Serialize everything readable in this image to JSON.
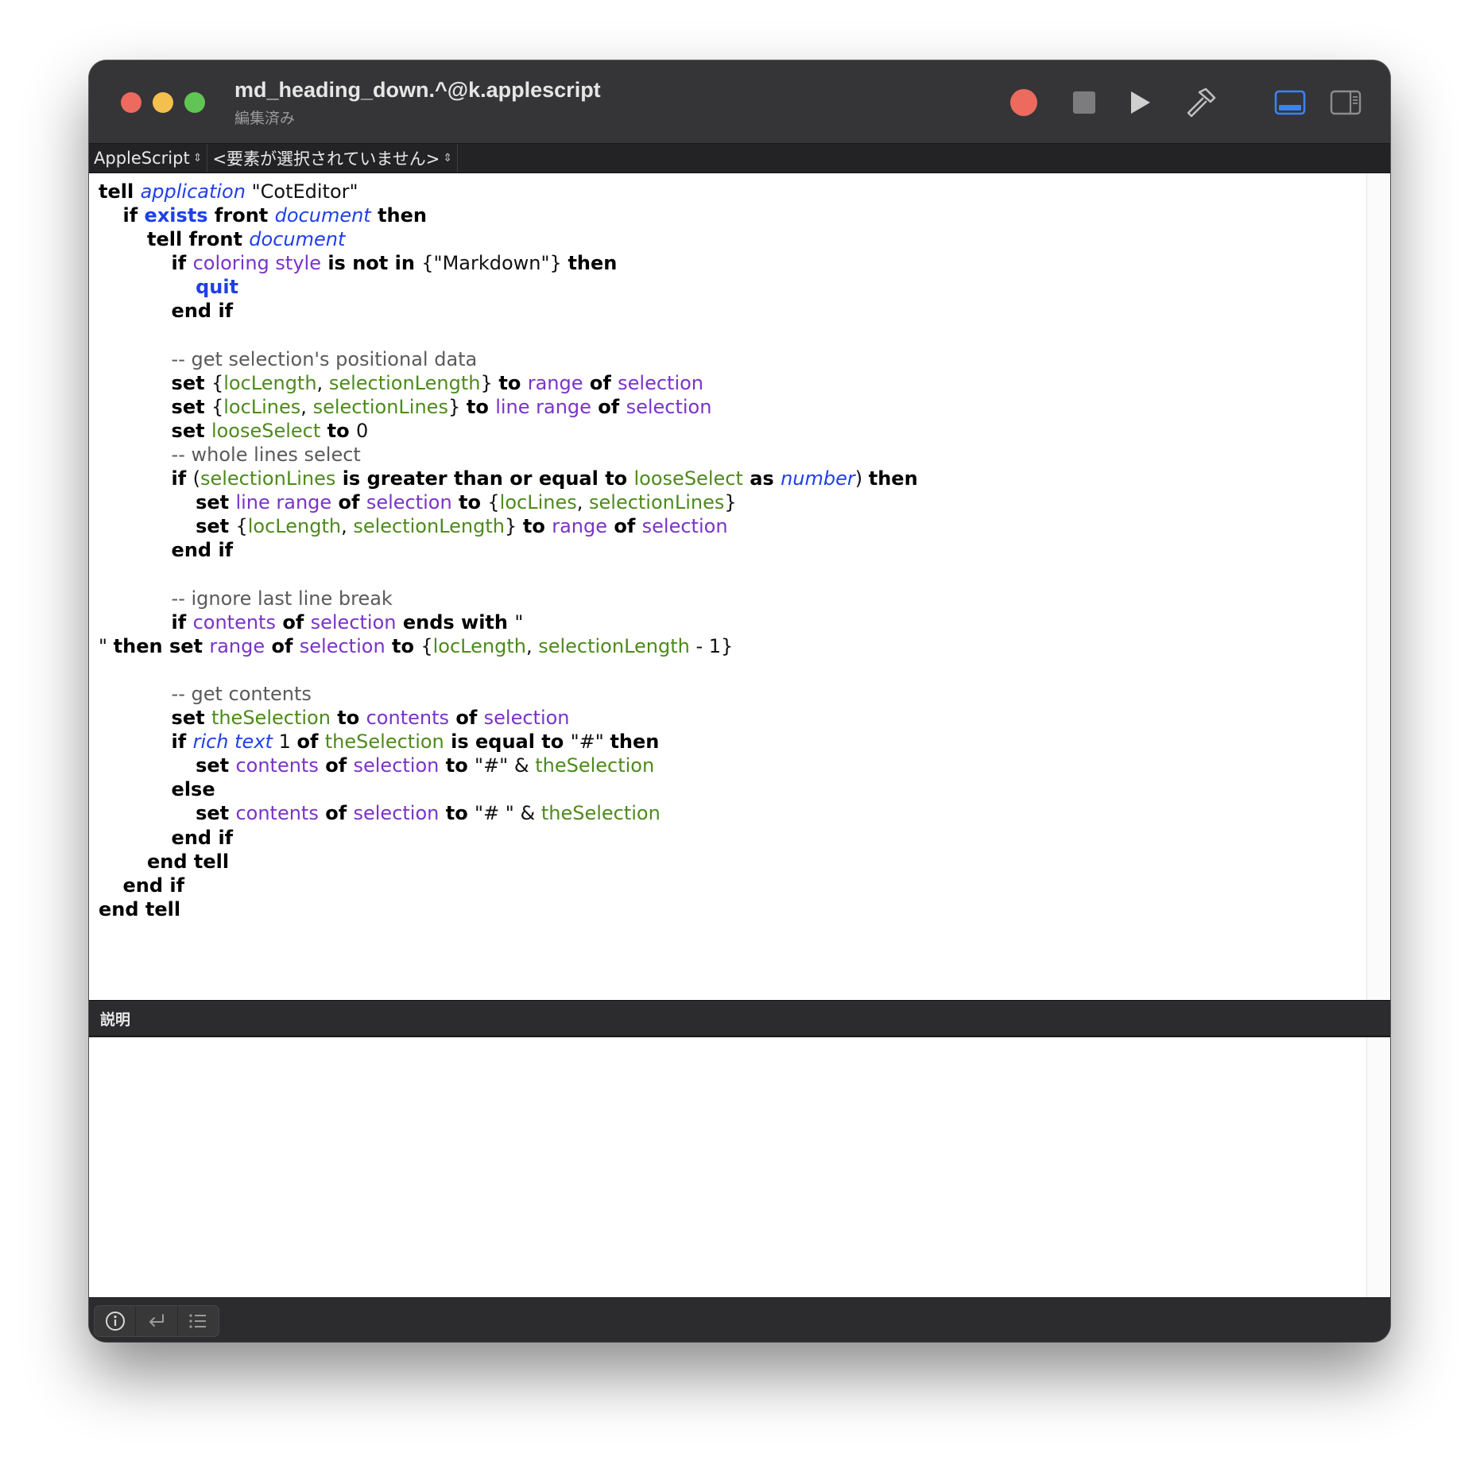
{
  "window": {
    "title": "md_heading_down.^@k.applescript",
    "subtitle": "編集済み"
  },
  "toolbar": {
    "record": "record-icon",
    "stop": "stop-icon",
    "run": "run-icon",
    "compile": "hammer-icon",
    "show_bottom_pane": "bottom-pane-icon",
    "show_side_pane": "side-pane-icon",
    "colors": {
      "record": "#ec6a5e",
      "active_pane": "#3b82f6"
    }
  },
  "navbar": {
    "language": "AppleScript",
    "element": "<要素が選択されていません>"
  },
  "code_lines": [
    [
      [
        "kw",
        "tell "
      ],
      [
        "cls",
        "application"
      ],
      [
        "plain",
        " \"CotEditor\""
      ]
    ],
    [
      [
        "plain",
        "\t"
      ],
      [
        "kw",
        "if "
      ],
      [
        "cmd",
        "exists"
      ],
      [
        "kw",
        " front "
      ],
      [
        "cls",
        "document"
      ],
      [
        "kw",
        " then"
      ]
    ],
    [
      [
        "plain",
        "\t\t"
      ],
      [
        "kw",
        "tell front "
      ],
      [
        "cls",
        "document"
      ]
    ],
    [
      [
        "plain",
        "\t\t\t"
      ],
      [
        "kw",
        "if "
      ],
      [
        "prop",
        "coloring style"
      ],
      [
        "kw",
        " is not in "
      ],
      [
        "plain",
        "{\"Markdown\"} "
      ],
      [
        "kw",
        "then"
      ]
    ],
    [
      [
        "plain",
        "\t\t\t\t"
      ],
      [
        "cmd",
        "quit"
      ]
    ],
    [
      [
        "plain",
        "\t\t\t"
      ],
      [
        "kw",
        "end if"
      ]
    ],
    [],
    [
      [
        "plain",
        "\t\t\t"
      ],
      [
        "cmt",
        "-- get selection's positional data"
      ]
    ],
    [
      [
        "plain",
        "\t\t\t"
      ],
      [
        "kw",
        "set "
      ],
      [
        "plain",
        "{"
      ],
      [
        "var",
        "locLength"
      ],
      [
        "plain",
        ", "
      ],
      [
        "var",
        "selectionLength"
      ],
      [
        "plain",
        "} "
      ],
      [
        "kw",
        "to "
      ],
      [
        "prop",
        "range"
      ],
      [
        "kw",
        " of "
      ],
      [
        "prop",
        "selection"
      ]
    ],
    [
      [
        "plain",
        "\t\t\t"
      ],
      [
        "kw",
        "set "
      ],
      [
        "plain",
        "{"
      ],
      [
        "var",
        "locLines"
      ],
      [
        "plain",
        ", "
      ],
      [
        "var",
        "selectionLines"
      ],
      [
        "plain",
        "} "
      ],
      [
        "kw",
        "to "
      ],
      [
        "prop",
        "line range"
      ],
      [
        "kw",
        " of "
      ],
      [
        "prop",
        "selection"
      ]
    ],
    [
      [
        "plain",
        "\t\t\t"
      ],
      [
        "kw",
        "set "
      ],
      [
        "var",
        "looseSelect"
      ],
      [
        "kw",
        " to "
      ],
      [
        "plain",
        "0"
      ]
    ],
    [
      [
        "plain",
        "\t\t\t"
      ],
      [
        "cmt",
        "-- whole lines select"
      ]
    ],
    [
      [
        "plain",
        "\t\t\t"
      ],
      [
        "kw",
        "if "
      ],
      [
        "plain",
        "("
      ],
      [
        "var",
        "selectionLines"
      ],
      [
        "kw",
        " is greater than or equal to "
      ],
      [
        "var",
        "looseSelect"
      ],
      [
        "kw",
        " as "
      ],
      [
        "cls",
        "number"
      ],
      [
        "plain",
        ") "
      ],
      [
        "kw",
        "then"
      ]
    ],
    [
      [
        "plain",
        "\t\t\t\t"
      ],
      [
        "kw",
        "set "
      ],
      [
        "prop",
        "line range"
      ],
      [
        "kw",
        " of "
      ],
      [
        "prop",
        "selection"
      ],
      [
        "kw",
        " to "
      ],
      [
        "plain",
        "{"
      ],
      [
        "var",
        "locLines"
      ],
      [
        "plain",
        ", "
      ],
      [
        "var",
        "selectionLines"
      ],
      [
        "plain",
        "}"
      ]
    ],
    [
      [
        "plain",
        "\t\t\t\t"
      ],
      [
        "kw",
        "set "
      ],
      [
        "plain",
        "{"
      ],
      [
        "var",
        "locLength"
      ],
      [
        "plain",
        ", "
      ],
      [
        "var",
        "selectionLength"
      ],
      [
        "plain",
        "} "
      ],
      [
        "kw",
        "to "
      ],
      [
        "prop",
        "range"
      ],
      [
        "kw",
        " of "
      ],
      [
        "prop",
        "selection"
      ]
    ],
    [
      [
        "plain",
        "\t\t\t"
      ],
      [
        "kw",
        "end if"
      ]
    ],
    [],
    [
      [
        "plain",
        "\t\t\t"
      ],
      [
        "cmt",
        "-- ignore last line break"
      ]
    ],
    [
      [
        "plain",
        "\t\t\t"
      ],
      [
        "kw",
        "if "
      ],
      [
        "prop",
        "contents"
      ],
      [
        "kw",
        " of "
      ],
      [
        "prop",
        "selection"
      ],
      [
        "kw",
        " ends with "
      ],
      [
        "plain",
        "\""
      ]
    ],
    [
      [
        "plain",
        "\" "
      ],
      [
        "kw",
        "then set "
      ],
      [
        "prop",
        "range"
      ],
      [
        "kw",
        " of "
      ],
      [
        "prop",
        "selection"
      ],
      [
        "kw",
        " to "
      ],
      [
        "plain",
        "{"
      ],
      [
        "var",
        "locLength"
      ],
      [
        "plain",
        ", "
      ],
      [
        "var",
        "selectionLength"
      ],
      [
        "plain",
        " - 1}"
      ]
    ],
    [],
    [
      [
        "plain",
        "\t\t\t"
      ],
      [
        "cmt",
        "-- get contents"
      ]
    ],
    [
      [
        "plain",
        "\t\t\t"
      ],
      [
        "kw",
        "set "
      ],
      [
        "var",
        "theSelection"
      ],
      [
        "kw",
        " to "
      ],
      [
        "prop",
        "contents"
      ],
      [
        "kw",
        " of "
      ],
      [
        "prop",
        "selection"
      ]
    ],
    [
      [
        "plain",
        "\t\t\t"
      ],
      [
        "kw",
        "if "
      ],
      [
        "cls",
        "rich text"
      ],
      [
        "plain",
        " 1 "
      ],
      [
        "kw",
        "of "
      ],
      [
        "var",
        "theSelection"
      ],
      [
        "kw",
        " is equal to "
      ],
      [
        "plain",
        "\"#\" "
      ],
      [
        "kw",
        "then"
      ]
    ],
    [
      [
        "plain",
        "\t\t\t\t"
      ],
      [
        "kw",
        "set "
      ],
      [
        "prop",
        "contents"
      ],
      [
        "kw",
        " of "
      ],
      [
        "prop",
        "selection"
      ],
      [
        "kw",
        " to "
      ],
      [
        "plain",
        "\"#\" & "
      ],
      [
        "var",
        "theSelection"
      ]
    ],
    [
      [
        "plain",
        "\t\t\t"
      ],
      [
        "kw",
        "else"
      ]
    ],
    [
      [
        "plain",
        "\t\t\t\t"
      ],
      [
        "kw",
        "set "
      ],
      [
        "prop",
        "contents"
      ],
      [
        "kw",
        " of "
      ],
      [
        "prop",
        "selection"
      ],
      [
        "kw",
        " to "
      ],
      [
        "plain",
        "\"# \" & "
      ],
      [
        "var",
        "theSelection"
      ]
    ],
    [
      [
        "plain",
        "\t\t\t"
      ],
      [
        "kw",
        "end if"
      ]
    ],
    [
      [
        "plain",
        "\t\t"
      ],
      [
        "kw",
        "end tell"
      ]
    ],
    [
      [
        "plain",
        "\t"
      ],
      [
        "kw",
        "end if"
      ]
    ],
    [
      [
        "kw",
        "end tell"
      ]
    ]
  ],
  "description": {
    "header": "説明",
    "text": ""
  },
  "bottom_bar": {
    "buttons": [
      "info-icon",
      "reply-icon",
      "list-icon"
    ]
  }
}
